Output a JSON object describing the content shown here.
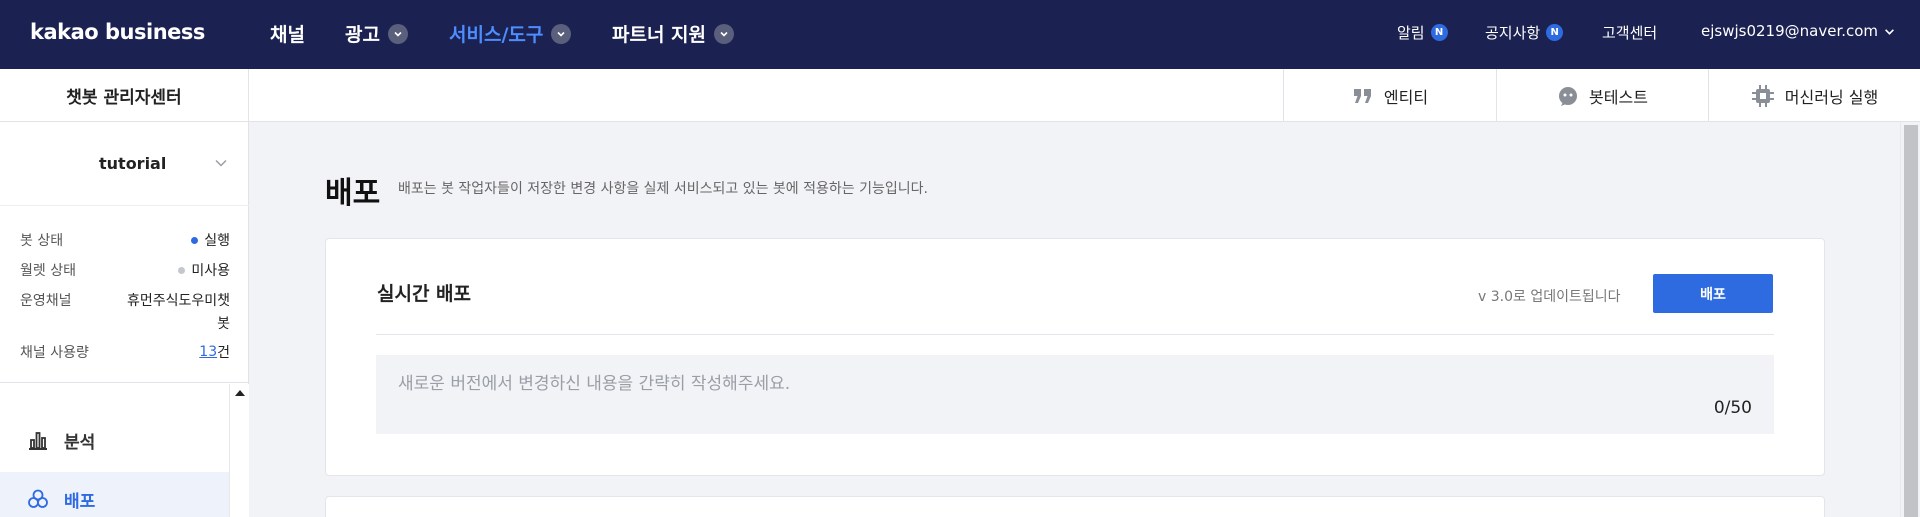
{
  "topnav": {
    "logo": "kakao business",
    "items": [
      {
        "label": "채널",
        "has_dropdown": false
      },
      {
        "label": "광고",
        "has_dropdown": true
      },
      {
        "label": "서비스/도구",
        "has_dropdown": true,
        "active": true
      },
      {
        "label": "파트너 지원",
        "has_dropdown": true
      }
    ],
    "utils": {
      "alarm": "알림",
      "alarm_badge": "N",
      "notice": "공지사항",
      "notice_badge": "N",
      "support": "고객센터",
      "account": "ejswjs0219@naver.com"
    }
  },
  "subheader": {
    "title": "챗봇 관리자센터",
    "tools": [
      {
        "label": "엔티티",
        "icon": "quote-icon"
      },
      {
        "label": "봇테스트",
        "icon": "chat-bot-icon"
      },
      {
        "label": "머신러닝 실행",
        "icon": "chip-icon"
      }
    ]
  },
  "sidebar": {
    "bot_name": "tutorial",
    "info": {
      "bot_status_label": "봇 상태",
      "bot_status_value": "실행",
      "wallet_status_label": "월렛 상태",
      "wallet_status_value": "미사용",
      "channel_label": "운영채널",
      "channel_value_line1": "휴먼주식도우미챗",
      "channel_value_line2": "봇",
      "usage_label": "채널 사용량",
      "usage_count": "13",
      "usage_unit": "건"
    },
    "menu": [
      {
        "label": "분석",
        "icon": "bar-chart-icon",
        "active": false
      },
      {
        "label": "배포",
        "icon": "deploy-icon",
        "active": true
      }
    ]
  },
  "main": {
    "heading": "배포",
    "description": "배포는 봇 작업자들이 저장한 변경 사항을 실제 서비스되고 있는 봇에 적용하는 기능입니다.",
    "card": {
      "title": "실시간 배포",
      "version_note": "v 3.0로 업데이트됩니다",
      "button": "배포",
      "textarea_placeholder": "새로운 버전에서 변경하신 내용을 간략히 작성해주세요.",
      "counter": "0/50"
    }
  },
  "colors": {
    "nav_bg": "#1b2150",
    "accent": "#2f6be0",
    "active_nav": "#4d8dff",
    "status_running": "#2f6be0",
    "status_unused": "#c4c7cd"
  }
}
